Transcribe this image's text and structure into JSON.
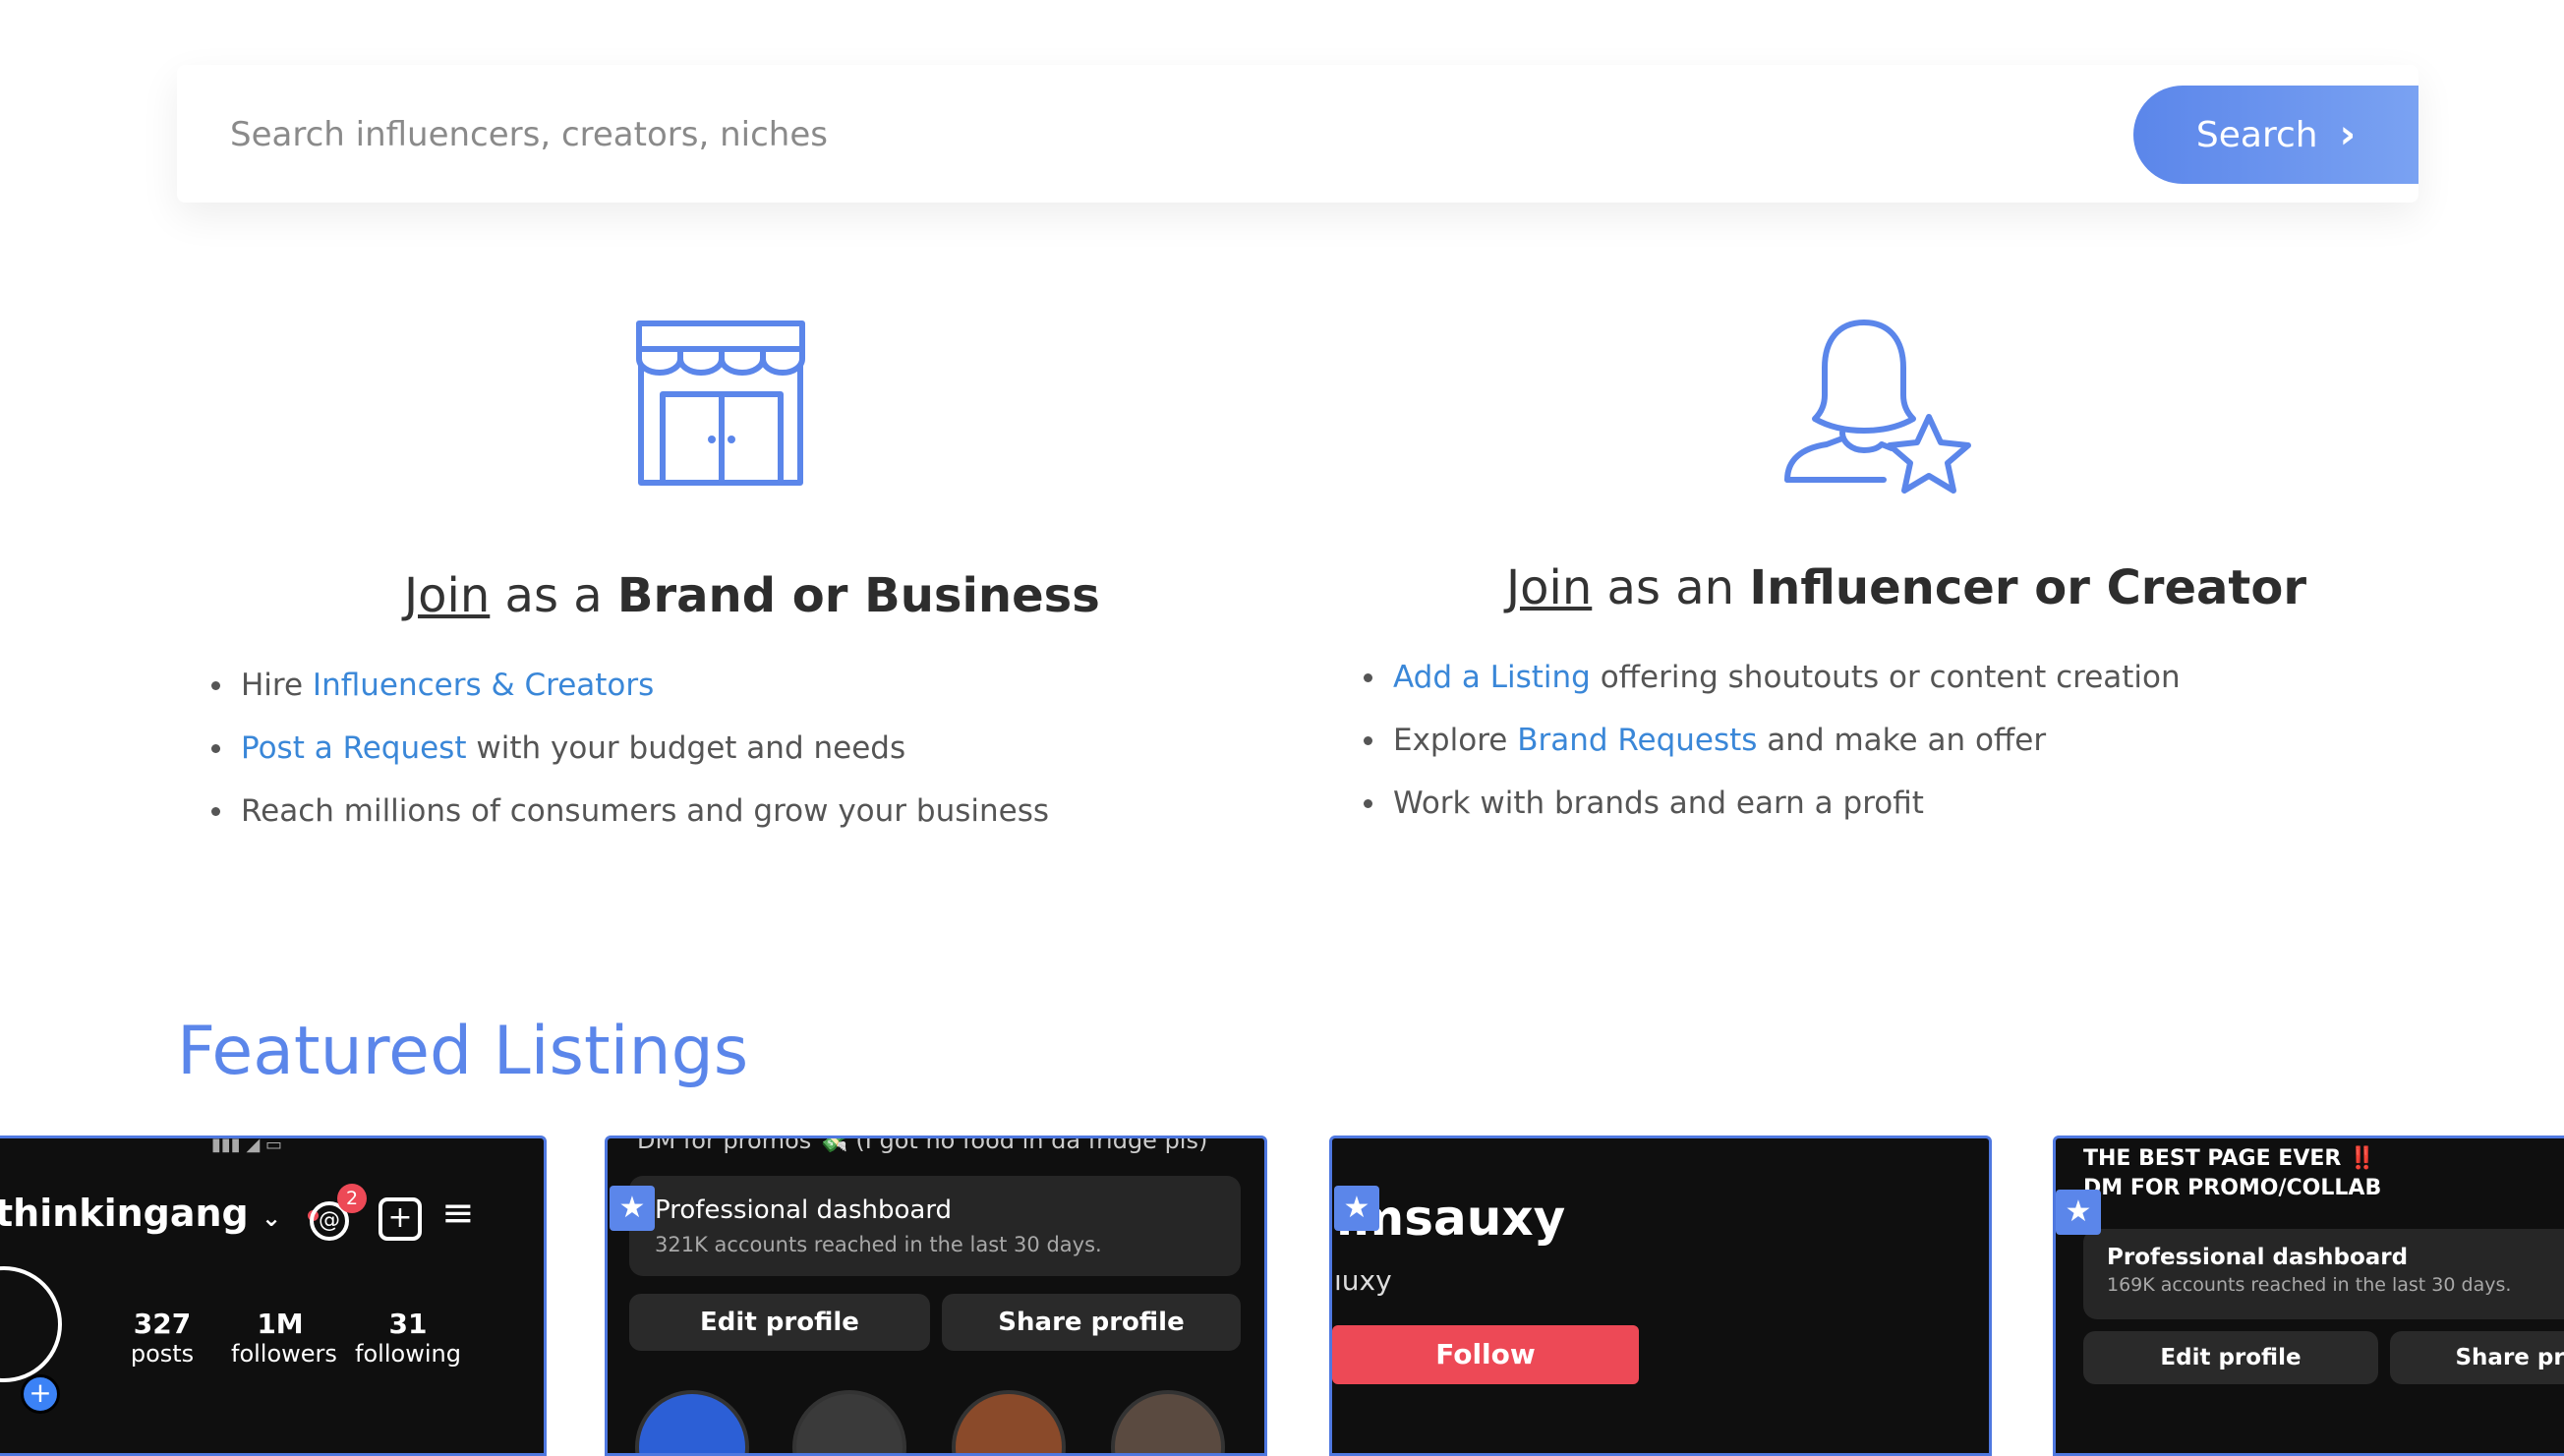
{
  "search": {
    "placeholder": "Search influencers, creators, niches",
    "button_label": "Search"
  },
  "brand": {
    "join_label": "Join",
    "title_mid": " as a ",
    "title_bold": "Brand or Business",
    "bullets": [
      {
        "pre": "Hire ",
        "link": "Influencers & Creators",
        "post": ""
      },
      {
        "pre": "",
        "link": "Post a Request",
        "post": " with your budget and needs"
      },
      {
        "pre": "Reach millions of consumers and grow your business",
        "link": "",
        "post": ""
      }
    ]
  },
  "influencer": {
    "join_label": "Join",
    "title_mid": " as an ",
    "title_bold": "Influencer or Creator",
    "bullets": [
      {
        "pre": "",
        "link": "Add a Listing",
        "post": " offering shoutouts or content creation"
      },
      {
        "pre": "Explore ",
        "link": "Brand Requests",
        "post": " and make an offer"
      },
      {
        "pre": "Work with brands and earn a profit",
        "link": "",
        "post": ""
      }
    ]
  },
  "featured": {
    "title": "Featured Listings",
    "cards": [
      {
        "username": "thinkingang",
        "notif_count": "2",
        "stats": [
          {
            "value": "327",
            "label": "posts"
          },
          {
            "value": "1M",
            "label": "followers"
          },
          {
            "value": "31",
            "label": "following"
          }
        ]
      },
      {
        "top_text": "DM for promos 💸 (I got no food in da fridge pls)",
        "dash_title": "Professional dashboard",
        "dash_sub": "321K accounts reached in the last 30 days.",
        "edit_label": "Edit profile",
        "share_label": "Share profile"
      },
      {
        "username": "ımsauxy",
        "handle": "ıuxy",
        "follow_label": "Follow"
      },
      {
        "bio_line1": "THE BEST PAGE EVER ‼️",
        "bio_line2": "DM FOR PROMO/COLLAB",
        "dash_title": "Professional dashboard",
        "dash_sub": "169K accounts reached in the last 30 days.",
        "edit_label": "Edit profile",
        "share_label": "Share pro"
      }
    ]
  },
  "colors": {
    "accent": "#5b86ea",
    "link": "#3a87d8",
    "follow": "#ed4956",
    "card_border": "#4f78e0"
  }
}
